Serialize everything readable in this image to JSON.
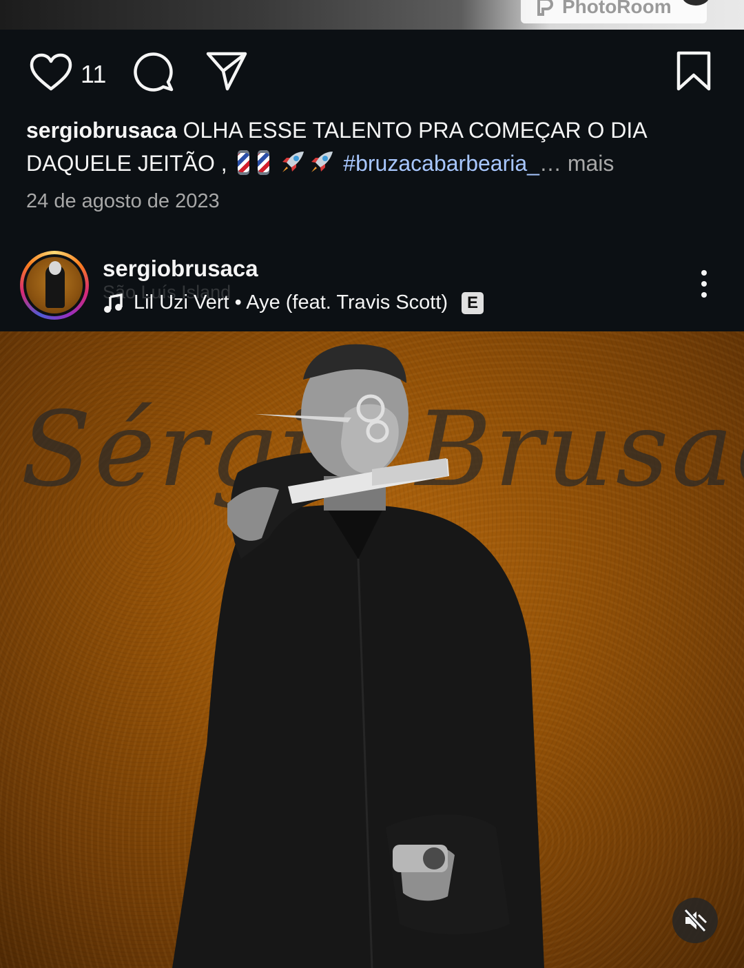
{
  "previous_post": {
    "badge_label": "PhotoRoom"
  },
  "actions": {
    "like_count": "11"
  },
  "caption": {
    "username": "sergiobrusaca",
    "text": "OLHA ESSE TALENTO PRA COMEÇAR O DIA DAQUELE JEITÃO ,",
    "hashtag": "#bruzacabarbearia_",
    "ellipsis": "…",
    "more_label": "mais"
  },
  "date": "24 de agosto de 2023",
  "post": {
    "username": "sergiobrusaca",
    "location": "São Luís Island",
    "music": "Lil Uzi Vert • Aye (feat. Travis Scott)",
    "explicit_label": "E",
    "media_watermark": "Sérgio Brusaca"
  },
  "icons": {
    "like": "heart-outline-icon",
    "comment": "speech-bubble-icon",
    "share": "paper-plane-icon",
    "save": "bookmark-outline-icon",
    "music": "music-note-icon",
    "more": "vertical-dots-icon",
    "mute": "speaker-muted-icon"
  },
  "colors": {
    "background": "#0c1014",
    "hashtag": "#a8c7ff",
    "secondary_text": "#a8a8a8"
  }
}
